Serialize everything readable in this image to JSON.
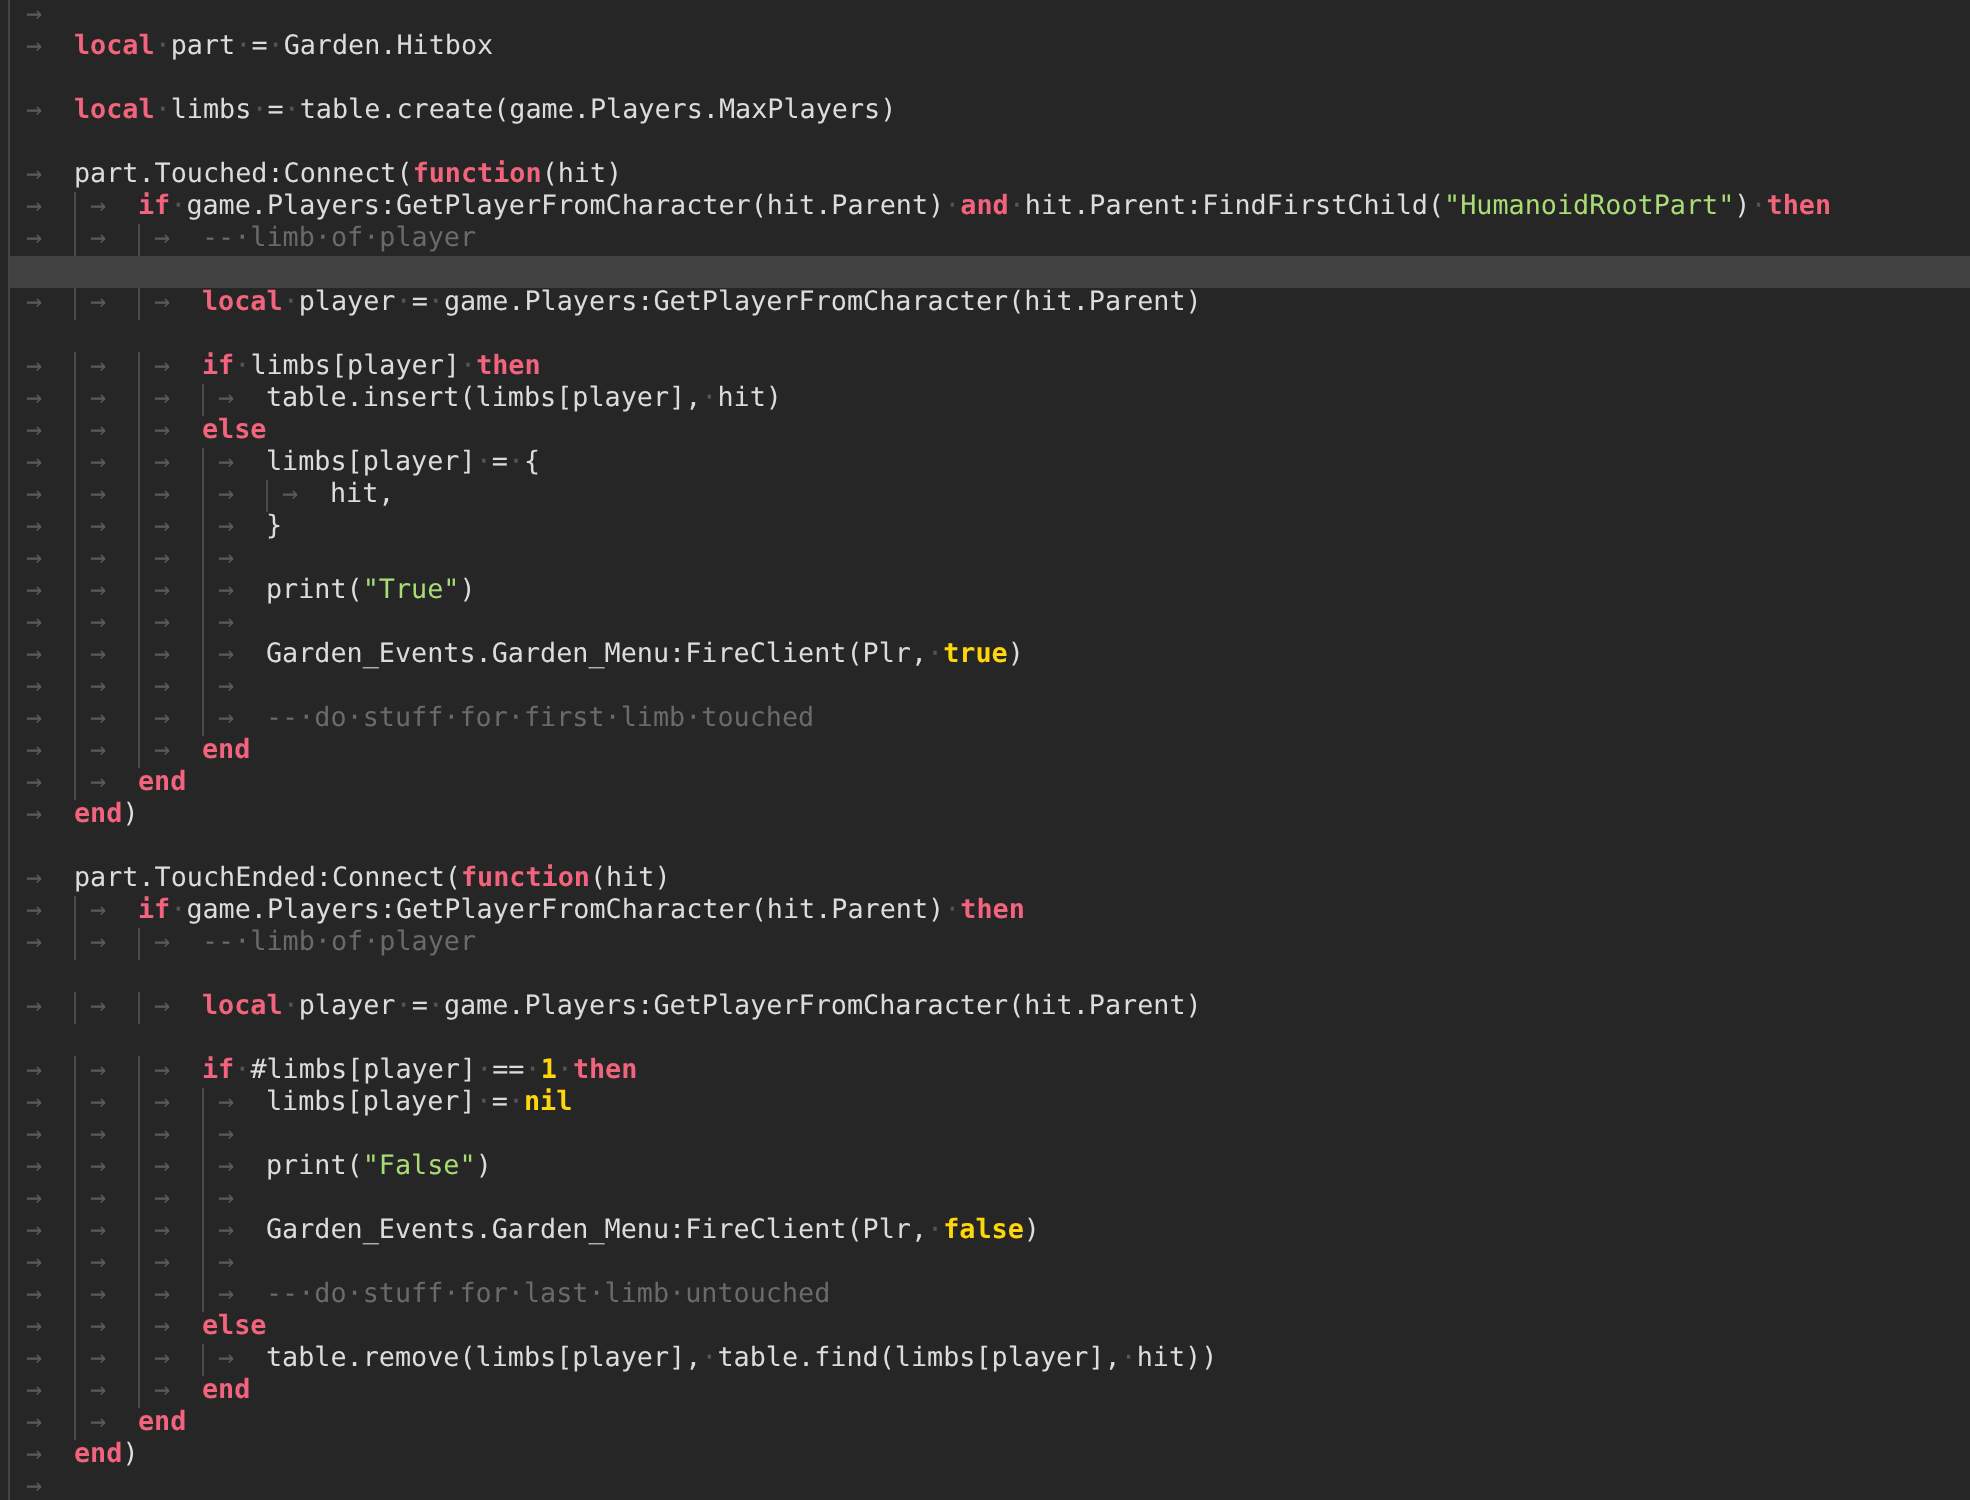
{
  "editor": {
    "lines": [
      {
        "kind": "code",
        "current": false,
        "tabs": "→"
      },
      {
        "kind": "code",
        "current": false,
        "tabs": "→",
        "tokens": [
          {
            "kind": "kw",
            "text": "local"
          },
          {
            "kind": "ws",
            "text": "·"
          },
          {
            "kind": "plain",
            "text": "part"
          },
          {
            "kind": "ws",
            "text": "·"
          },
          {
            "kind": "plain",
            "text": "="
          },
          {
            "kind": "ws",
            "text": "·"
          },
          {
            "kind": "plain",
            "text": "Garden.Hitbox"
          }
        ]
      },
      {
        "kind": "blank",
        "current": false
      },
      {
        "kind": "code",
        "current": false,
        "tabs": "→",
        "tokens": [
          {
            "kind": "kw",
            "text": "local"
          },
          {
            "kind": "ws",
            "text": "·"
          },
          {
            "kind": "plain",
            "text": "limbs"
          },
          {
            "kind": "ws",
            "text": "·"
          },
          {
            "kind": "plain",
            "text": "="
          },
          {
            "kind": "ws",
            "text": "·"
          },
          {
            "kind": "plain",
            "text": "table.create(game.Players.MaxPlayers)"
          }
        ]
      },
      {
        "kind": "blank",
        "current": false
      },
      {
        "kind": "code",
        "current": false,
        "tabs": "→",
        "tokens": [
          {
            "kind": "plain",
            "text": "part.Touched:Connect("
          },
          {
            "kind": "kw",
            "text": "function"
          },
          {
            "kind": "plain",
            "text": "(hit)"
          }
        ]
      },
      {
        "kind": "code",
        "current": false,
        "tabs": "→→",
        "tokens": [
          {
            "kind": "kw",
            "text": "if"
          },
          {
            "kind": "ws",
            "text": "·"
          },
          {
            "kind": "plain",
            "text": "game.Players:GetPlayerFromCharacter(hit.Parent)"
          },
          {
            "kind": "ws",
            "text": "·"
          },
          {
            "kind": "kw",
            "text": "and"
          },
          {
            "kind": "ws",
            "text": "·"
          },
          {
            "kind": "plain",
            "text": "hit.Parent:FindFirstChild("
          },
          {
            "kind": "str",
            "text": "\"HumanoidRootPart\""
          },
          {
            "kind": "plain",
            "text": ")"
          },
          {
            "kind": "ws",
            "text": "·"
          },
          {
            "kind": "kw",
            "text": "then"
          }
        ]
      },
      {
        "kind": "code",
        "current": false,
        "tabs": "→→→",
        "tokens": [
          {
            "kind": "comment",
            "text": "--·limb·of·player"
          }
        ]
      },
      {
        "kind": "blank",
        "current": true
      },
      {
        "kind": "code",
        "current": false,
        "tabs": "→→→",
        "tokens": [
          {
            "kind": "kw",
            "text": "local"
          },
          {
            "kind": "ws",
            "text": "·"
          },
          {
            "kind": "plain",
            "text": "player"
          },
          {
            "kind": "ws",
            "text": "·"
          },
          {
            "kind": "plain",
            "text": "="
          },
          {
            "kind": "ws",
            "text": "·"
          },
          {
            "kind": "plain",
            "text": "game.Players:GetPlayerFromCharacter(hit.Parent)"
          }
        ]
      },
      {
        "kind": "blank",
        "current": false
      },
      {
        "kind": "code",
        "current": false,
        "tabs": "→→→",
        "tokens": [
          {
            "kind": "kw",
            "text": "if"
          },
          {
            "kind": "ws",
            "text": "·"
          },
          {
            "kind": "plain",
            "text": "limbs[player]"
          },
          {
            "kind": "ws",
            "text": "·"
          },
          {
            "kind": "kw",
            "text": "then"
          }
        ]
      },
      {
        "kind": "code",
        "current": false,
        "tabs": "→→→→",
        "tokens": [
          {
            "kind": "plain",
            "text": "table.insert(limbs[player],"
          },
          {
            "kind": "ws",
            "text": "·"
          },
          {
            "kind": "plain",
            "text": "hit)"
          }
        ]
      },
      {
        "kind": "code",
        "current": false,
        "tabs": "→→→",
        "tokens": [
          {
            "kind": "kw",
            "text": "else"
          }
        ]
      },
      {
        "kind": "code",
        "current": false,
        "tabs": "→→→→",
        "tokens": [
          {
            "kind": "plain",
            "text": "limbs[player]"
          },
          {
            "kind": "ws",
            "text": "·"
          },
          {
            "kind": "plain",
            "text": "="
          },
          {
            "kind": "ws",
            "text": "·"
          },
          {
            "kind": "plain",
            "text": "{"
          }
        ]
      },
      {
        "kind": "code",
        "current": false,
        "tabs": "→→→→→",
        "tokens": [
          {
            "kind": "plain",
            "text": "hit,"
          }
        ]
      },
      {
        "kind": "code",
        "current": false,
        "tabs": "→→→→",
        "tokens": [
          {
            "kind": "plain",
            "text": "}"
          }
        ]
      },
      {
        "kind": "code",
        "current": false,
        "tabs": "→→→→"
      },
      {
        "kind": "code",
        "current": false,
        "tabs": "→→→→",
        "tokens": [
          {
            "kind": "plain",
            "text": "print("
          },
          {
            "kind": "str",
            "text": "\"True\""
          },
          {
            "kind": "plain",
            "text": ")"
          }
        ]
      },
      {
        "kind": "code",
        "current": false,
        "tabs": "→→→→"
      },
      {
        "kind": "code",
        "current": false,
        "tabs": "→→→→",
        "tokens": [
          {
            "kind": "plain",
            "text": "Garden_Events.Garden_Menu:FireClient(Plr,"
          },
          {
            "kind": "ws",
            "text": "·"
          },
          {
            "kind": "lit",
            "text": "true"
          },
          {
            "kind": "plain",
            "text": ")"
          }
        ]
      },
      {
        "kind": "code",
        "current": false,
        "tabs": "→→→→"
      },
      {
        "kind": "code",
        "current": false,
        "tabs": "→→→→",
        "tokens": [
          {
            "kind": "comment",
            "text": "--·do·stuff·for·first·limb·touched"
          }
        ]
      },
      {
        "kind": "code",
        "current": false,
        "tabs": "→→→",
        "tokens": [
          {
            "kind": "kw",
            "text": "end"
          }
        ]
      },
      {
        "kind": "code",
        "current": false,
        "tabs": "→→",
        "tokens": [
          {
            "kind": "kw",
            "text": "end"
          }
        ]
      },
      {
        "kind": "code",
        "current": false,
        "tabs": "→",
        "tokens": [
          {
            "kind": "kw",
            "text": "end"
          },
          {
            "kind": "plain",
            "text": ")"
          }
        ]
      },
      {
        "kind": "blank",
        "current": false
      },
      {
        "kind": "code",
        "current": false,
        "tabs": "→",
        "tokens": [
          {
            "kind": "plain",
            "text": "part.TouchEnded:Connect("
          },
          {
            "kind": "kw",
            "text": "function"
          },
          {
            "kind": "plain",
            "text": "(hit)"
          }
        ]
      },
      {
        "kind": "code",
        "current": false,
        "tabs": "→→",
        "tokens": [
          {
            "kind": "kw",
            "text": "if"
          },
          {
            "kind": "ws",
            "text": "·"
          },
          {
            "kind": "plain",
            "text": "game.Players:GetPlayerFromCharacter(hit.Parent)"
          },
          {
            "kind": "ws",
            "text": "·"
          },
          {
            "kind": "kw",
            "text": "then"
          }
        ]
      },
      {
        "kind": "code",
        "current": false,
        "tabs": "→→→",
        "tokens": [
          {
            "kind": "comment",
            "text": "--·limb·of·player"
          }
        ]
      },
      {
        "kind": "blank",
        "current": false
      },
      {
        "kind": "code",
        "current": false,
        "tabs": "→→→",
        "tokens": [
          {
            "kind": "kw",
            "text": "local"
          },
          {
            "kind": "ws",
            "text": "·"
          },
          {
            "kind": "plain",
            "text": "player"
          },
          {
            "kind": "ws",
            "text": "·"
          },
          {
            "kind": "plain",
            "text": "="
          },
          {
            "kind": "ws",
            "text": "·"
          },
          {
            "kind": "plain",
            "text": "game.Players:GetPlayerFromCharacter(hit.Parent)"
          }
        ]
      },
      {
        "kind": "blank",
        "current": false
      },
      {
        "kind": "code",
        "current": false,
        "tabs": "→→→",
        "tokens": [
          {
            "kind": "kw",
            "text": "if"
          },
          {
            "kind": "ws",
            "text": "·"
          },
          {
            "kind": "plain",
            "text": "#limbs[player]"
          },
          {
            "kind": "ws",
            "text": "·"
          },
          {
            "kind": "plain",
            "text": "=="
          },
          {
            "kind": "ws",
            "text": "·"
          },
          {
            "kind": "lit",
            "text": "1"
          },
          {
            "kind": "ws",
            "text": "·"
          },
          {
            "kind": "kw",
            "text": "then"
          }
        ]
      },
      {
        "kind": "code",
        "current": false,
        "tabs": "→→→→",
        "tokens": [
          {
            "kind": "plain",
            "text": "limbs[player]"
          },
          {
            "kind": "ws",
            "text": "·"
          },
          {
            "kind": "plain",
            "text": "="
          },
          {
            "kind": "ws",
            "text": "·"
          },
          {
            "kind": "lit",
            "text": "nil"
          }
        ]
      },
      {
        "kind": "code",
        "current": false,
        "tabs": "→→→→"
      },
      {
        "kind": "code",
        "current": false,
        "tabs": "→→→→",
        "tokens": [
          {
            "kind": "plain",
            "text": "print("
          },
          {
            "kind": "str",
            "text": "\"False\""
          },
          {
            "kind": "plain",
            "text": ")"
          }
        ]
      },
      {
        "kind": "code",
        "current": false,
        "tabs": "→→→→"
      },
      {
        "kind": "code",
        "current": false,
        "tabs": "→→→→",
        "tokens": [
          {
            "kind": "plain",
            "text": "Garden_Events.Garden_Menu:FireClient(Plr,"
          },
          {
            "kind": "ws",
            "text": "·"
          },
          {
            "kind": "lit",
            "text": "false"
          },
          {
            "kind": "plain",
            "text": ")"
          }
        ]
      },
      {
        "kind": "code",
        "current": false,
        "tabs": "→→→→"
      },
      {
        "kind": "code",
        "current": false,
        "tabs": "→→→→",
        "tokens": [
          {
            "kind": "comment",
            "text": "--·do·stuff·for·last·limb·untouched"
          }
        ]
      },
      {
        "kind": "code",
        "current": false,
        "tabs": "→→→",
        "tokens": [
          {
            "kind": "kw",
            "text": "else"
          }
        ]
      },
      {
        "kind": "code",
        "current": false,
        "tabs": "→→→→",
        "tokens": [
          {
            "kind": "plain",
            "text": "table.remove(limbs[player],"
          },
          {
            "kind": "ws",
            "text": "·"
          },
          {
            "kind": "plain",
            "text": "table.find(limbs[player],"
          },
          {
            "kind": "ws",
            "text": "·"
          },
          {
            "kind": "plain",
            "text": "hit))"
          }
        ]
      },
      {
        "kind": "code",
        "current": false,
        "tabs": "→→→",
        "tokens": [
          {
            "kind": "kw",
            "text": "end"
          }
        ]
      },
      {
        "kind": "code",
        "current": false,
        "tabs": "→→",
        "tokens": [
          {
            "kind": "kw",
            "text": "end"
          }
        ]
      },
      {
        "kind": "code",
        "current": false,
        "tabs": "→",
        "tokens": [
          {
            "kind": "kw",
            "text": "end"
          },
          {
            "kind": "plain",
            "text": ")"
          }
        ]
      },
      {
        "kind": "code",
        "current": false,
        "tabs": "→"
      }
    ]
  }
}
